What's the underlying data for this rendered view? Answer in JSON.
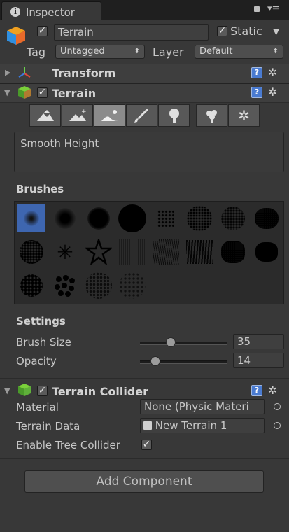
{
  "tab": {
    "title": "Inspector"
  },
  "gameobject": {
    "name": "Terrain",
    "static_label": "Static",
    "tag_label": "Tag",
    "tag_value": "Untagged",
    "layer_label": "Layer",
    "layer_value": "Default"
  },
  "components": {
    "transform": {
      "title": "Transform"
    },
    "terrain": {
      "title": "Terrain"
    },
    "collider": {
      "title": "Terrain Collider"
    }
  },
  "tool_description": "Smooth Height",
  "brushes_label": "Brushes",
  "settings": {
    "label": "Settings",
    "brush_size_label": "Brush Size",
    "brush_size_value": "35",
    "brush_size_fraction": 0.34,
    "opacity_label": "Opacity",
    "opacity_value": "14",
    "opacity_fraction": 0.14
  },
  "collider": {
    "material_label": "Material",
    "material_value": "None (Physic Materi",
    "terrain_data_label": "Terrain Data",
    "terrain_data_value": "New Terrain 1",
    "enable_tree_label": "Enable Tree Collider"
  },
  "add_component_label": "Add Component"
}
